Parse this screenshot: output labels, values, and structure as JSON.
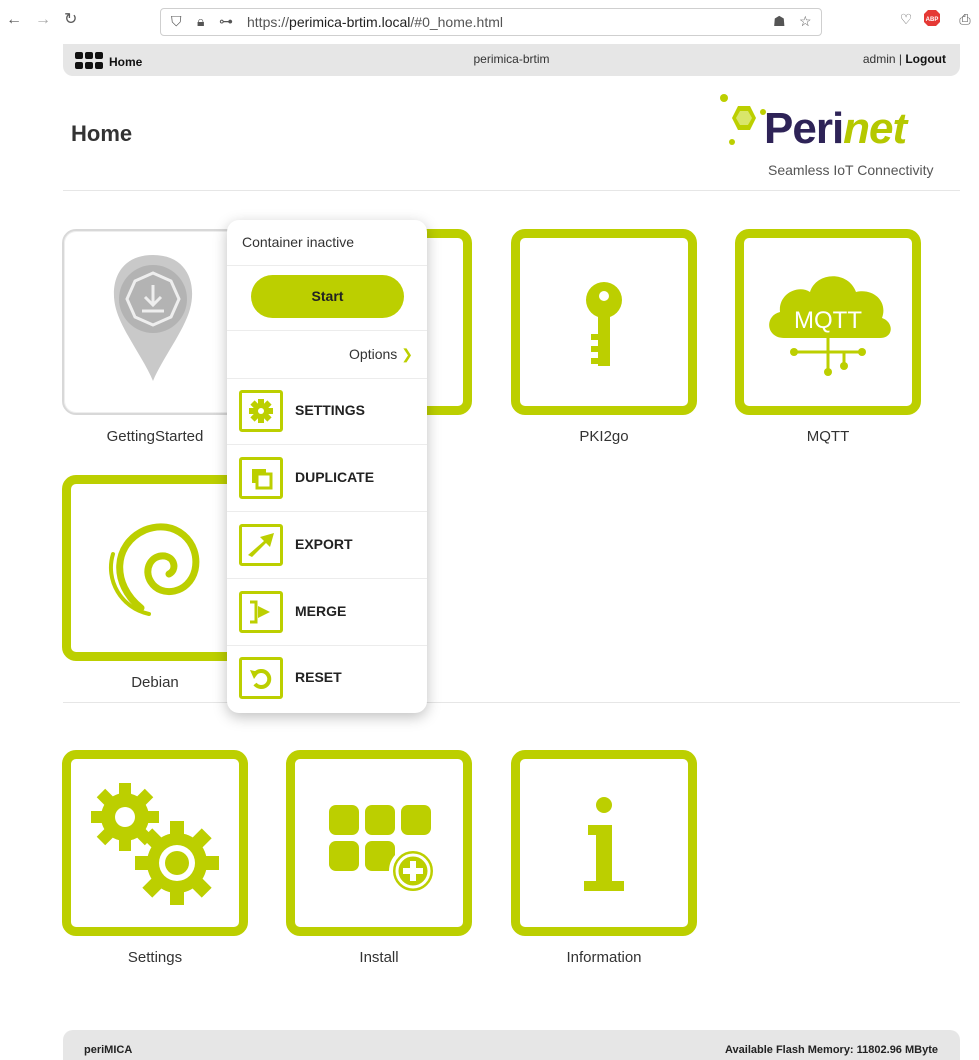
{
  "browser": {
    "url_host": "perimica-brtim.local",
    "url_prefix": "https://",
    "url_path": "/#0_home.html"
  },
  "app_bar": {
    "home_label": "Home",
    "host_name": "perimica-brtim",
    "user": "admin",
    "separator": " | ",
    "logout_label": "Logout"
  },
  "page": {
    "title": "Home",
    "logo_main": "Peri",
    "logo_accent": "net",
    "logo_tagline": "Seamless IoT Connectivity"
  },
  "tiles": {
    "getting_started": "GettingStarted",
    "pki2go": "PKI2go",
    "mqtt": "MQTT",
    "mqtt_icon_text": "MQTT",
    "debian": "Debian",
    "settings": "Settings",
    "install": "Install",
    "information": "Information"
  },
  "popup": {
    "status": "Container inactive",
    "start_label": "Start",
    "options_label": "Options",
    "items": [
      {
        "label": "SETTINGS",
        "icon": "gear-icon"
      },
      {
        "label": "DUPLICATE",
        "icon": "duplicate-icon"
      },
      {
        "label": "EXPORT",
        "icon": "export-arrow-icon"
      },
      {
        "label": "MERGE",
        "icon": "merge-icon"
      },
      {
        "label": "RESET",
        "icon": "reset-icon"
      }
    ]
  },
  "footer": {
    "left": "periMICA",
    "right": "Available Flash Memory: 11802.96 MByte"
  },
  "colors": {
    "accent": "#bccf00",
    "brand_dark": "#2e2357"
  }
}
